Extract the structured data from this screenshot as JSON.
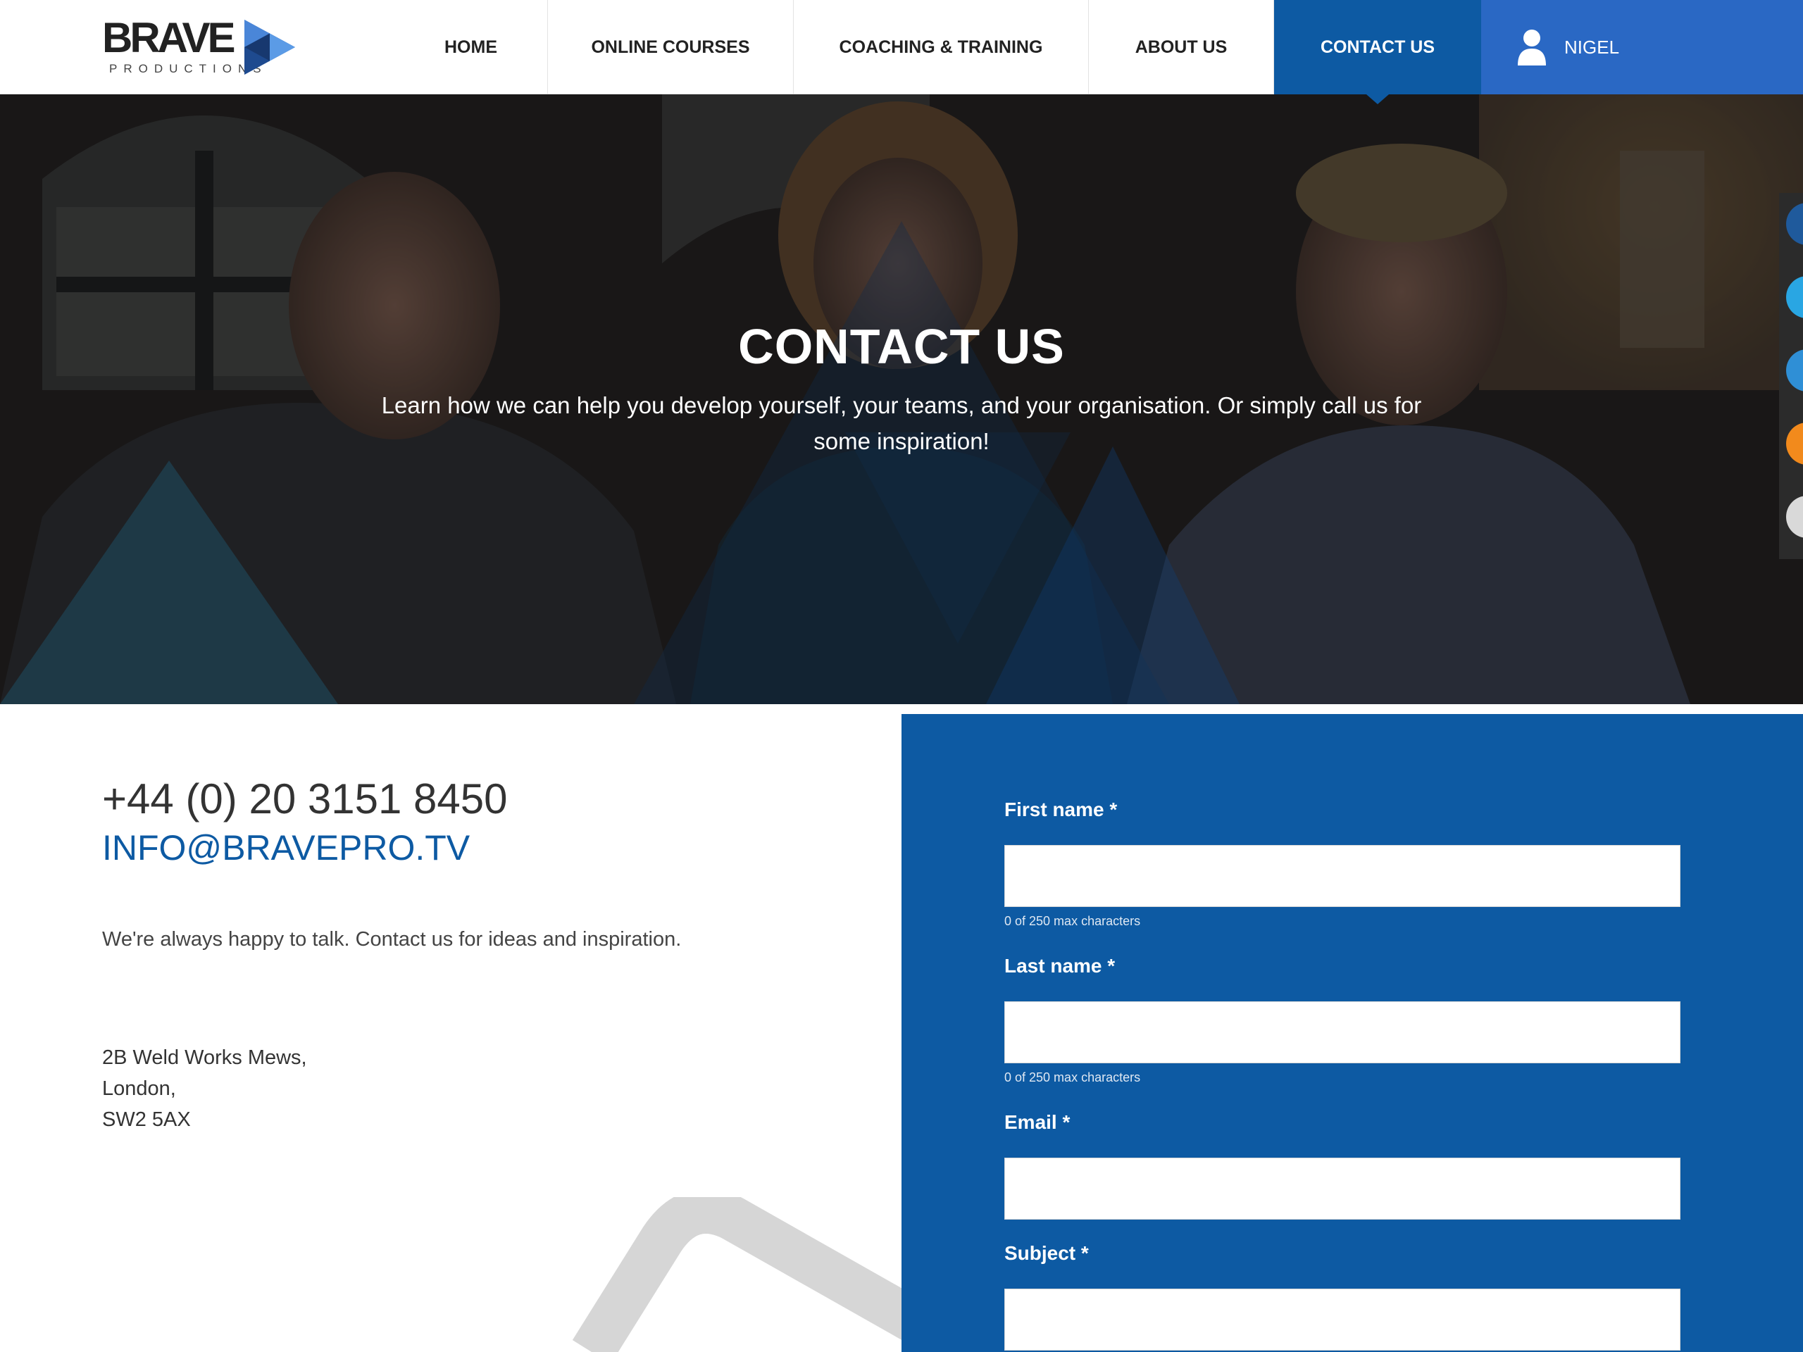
{
  "brand": {
    "name": "BRAVE",
    "subtitle": "PRODUCTIONS"
  },
  "nav": {
    "items": [
      {
        "label": "HOME",
        "active": false
      },
      {
        "label": "ONLINE COURSES",
        "active": false
      },
      {
        "label": "COACHING & TRAINING",
        "active": false
      },
      {
        "label": "ABOUT US",
        "active": false
      },
      {
        "label": "CONTACT US",
        "active": true
      }
    ],
    "user": {
      "label": "NIGEL",
      "icon": "user-icon"
    }
  },
  "hero": {
    "title": "CONTACT US",
    "subtitle": "Learn how we can help you develop yourself, your teams, and your organisation. Or simply call us for some inspiration!"
  },
  "contact": {
    "phone": "+44 (0) 20 3151 8450",
    "email": "INFO@BRAVEPRO.TV",
    "intro": "We're always happy to talk. Contact us for ideas and inspiration.",
    "address": [
      "2B Weld Works Mews,",
      "London,",
      "SW2 5AX"
    ]
  },
  "form": {
    "first_name": {
      "label": "First name *",
      "value": "",
      "hint": "0 of 250 max characters"
    },
    "last_name": {
      "label": "Last name *",
      "value": "",
      "hint": "0 of 250 max characters"
    },
    "email": {
      "label": "Email *",
      "value": ""
    },
    "subject": {
      "label": "Subject *",
      "value": ""
    }
  },
  "colors": {
    "primary": "#0d5aa3",
    "user_bar": "#2a68c4",
    "social": [
      "#1f5a9c",
      "#29a6e3",
      "#2f8fd6",
      "#f28a1c",
      "#d9d9d9"
    ]
  }
}
